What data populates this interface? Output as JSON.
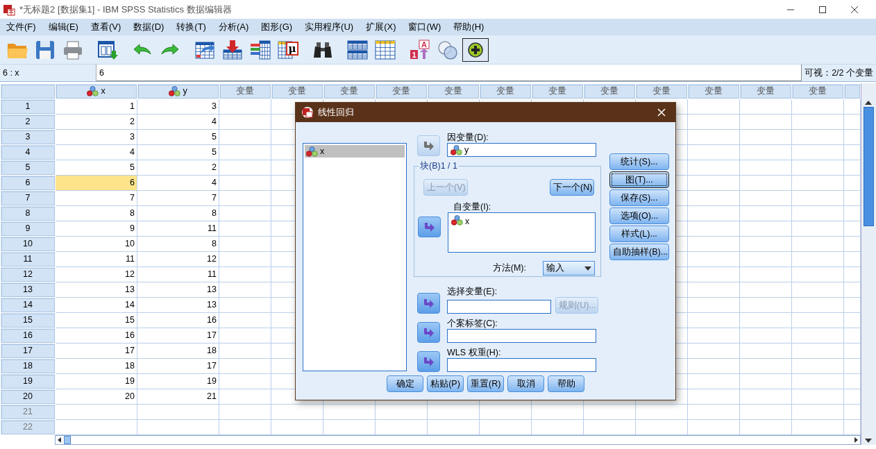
{
  "window": {
    "title": "*无标题2 [数据集1] - IBM SPSS Statistics 数据编辑器"
  },
  "menu": [
    "文件(F)",
    "编辑(E)",
    "查看(V)",
    "数据(D)",
    "转换(T)",
    "分析(A)",
    "图形(G)",
    "实用程序(U)",
    "扩展(X)",
    "窗口(W)",
    "帮助(H)"
  ],
  "toolbar": [
    [
      {
        "kind": "folder",
        "selected": false
      },
      {
        "kind": "floppy",
        "selected": false
      },
      {
        "kind": "printer",
        "selected": false
      }
    ],
    [
      {
        "kind": "window-arrow",
        "selected": false
      }
    ],
    [
      {
        "kind": "undo",
        "selected": false
      },
      {
        "kind": "redo",
        "selected": false
      }
    ],
    [
      {
        "kind": "grid-arrow",
        "selected": false
      },
      {
        "kind": "grid-down",
        "selected": false
      },
      {
        "kind": "grid-bars",
        "selected": false
      },
      {
        "kind": "grid-mu",
        "selected": false,
        "text": [
          "μ"
        ]
      }
    ],
    [
      {
        "kind": "binoculars",
        "selected": false
      }
    ],
    [
      {
        "kind": "two-grids",
        "selected": false
      },
      {
        "kind": "grid-plain",
        "selected": false
      }
    ],
    [
      {
        "kind": "labels",
        "selected": false,
        "text": [
          "A",
          "1"
        ]
      },
      {
        "kind": "circles",
        "selected": false
      },
      {
        "kind": "plus-circle",
        "selected": true
      }
    ]
  ],
  "cell_bar": {
    "reference": "6 : x",
    "value": "6",
    "visible": "可视：2/2 个变量"
  },
  "grid": {
    "columns": [
      {
        "label": "x",
        "kind": "variable"
      },
      {
        "label": "y",
        "kind": "variable"
      },
      {
        "label": "变量",
        "kind": "empty"
      },
      {
        "label": "变量",
        "kind": "empty"
      },
      {
        "label": "变量",
        "kind": "empty"
      },
      {
        "label": "变量",
        "kind": "empty"
      },
      {
        "label": "变量",
        "kind": "empty"
      },
      {
        "label": "变量",
        "kind": "empty"
      },
      {
        "label": "变量",
        "kind": "empty"
      },
      {
        "label": "变量",
        "kind": "empty"
      },
      {
        "label": "变量",
        "kind": "empty"
      },
      {
        "label": "变量",
        "kind": "empty"
      },
      {
        "label": "变量",
        "kind": "empty"
      },
      {
        "label": "变量",
        "kind": "empty"
      }
    ],
    "rows": [
      {
        "label": "1",
        "kind": "data",
        "cells": [
          {
            "value": "1",
            "selected": false
          },
          {
            "value": "3",
            "selected": false
          }
        ]
      },
      {
        "label": "2",
        "kind": "data",
        "cells": [
          {
            "value": "2",
            "selected": false
          },
          {
            "value": "4",
            "selected": false
          }
        ]
      },
      {
        "label": "3",
        "kind": "data",
        "cells": [
          {
            "value": "3",
            "selected": false
          },
          {
            "value": "5",
            "selected": false
          }
        ]
      },
      {
        "label": "4",
        "kind": "data",
        "cells": [
          {
            "value": "4",
            "selected": false
          },
          {
            "value": "5",
            "selected": false
          }
        ]
      },
      {
        "label": "5",
        "kind": "data",
        "cells": [
          {
            "value": "5",
            "selected": false
          },
          {
            "value": "2",
            "selected": false
          }
        ]
      },
      {
        "label": "6",
        "kind": "data",
        "cells": [
          {
            "value": "6",
            "selected": true
          },
          {
            "value": "4",
            "selected": false
          }
        ]
      },
      {
        "label": "7",
        "kind": "data",
        "cells": [
          {
            "value": "7",
            "selected": false
          },
          {
            "value": "7",
            "selected": false
          }
        ]
      },
      {
        "label": "8",
        "kind": "data",
        "cells": [
          {
            "value": "8",
            "selected": false
          },
          {
            "value": "8",
            "selected": false
          }
        ]
      },
      {
        "label": "9",
        "kind": "data",
        "cells": [
          {
            "value": "9",
            "selected": false
          },
          {
            "value": "11",
            "selected": false
          }
        ]
      },
      {
        "label": "10",
        "kind": "data",
        "cells": [
          {
            "value": "10",
            "selected": false
          },
          {
            "value": "8",
            "selected": false
          }
        ]
      },
      {
        "label": "11",
        "kind": "data",
        "cells": [
          {
            "value": "11",
            "selected": false
          },
          {
            "value": "12",
            "selected": false
          }
        ]
      },
      {
        "label": "12",
        "kind": "data",
        "cells": [
          {
            "value": "12",
            "selected": false
          },
          {
            "value": "11",
            "selected": false
          }
        ]
      },
      {
        "label": "13",
        "kind": "data",
        "cells": [
          {
            "value": "13",
            "selected": false
          },
          {
            "value": "13",
            "selected": false
          }
        ]
      },
      {
        "label": "14",
        "kind": "data",
        "cells": [
          {
            "value": "14",
            "selected": false
          },
          {
            "value": "13",
            "selected": false
          }
        ]
      },
      {
        "label": "15",
        "kind": "data",
        "cells": [
          {
            "value": "15",
            "selected": false
          },
          {
            "value": "16",
            "selected": false
          }
        ]
      },
      {
        "label": "16",
        "kind": "data",
        "cells": [
          {
            "value": "16",
            "selected": false
          },
          {
            "value": "17",
            "selected": false
          }
        ]
      },
      {
        "label": "17",
        "kind": "data",
        "cells": [
          {
            "value": "17",
            "selected": false
          },
          {
            "value": "18",
            "selected": false
          }
        ]
      },
      {
        "label": "18",
        "kind": "data",
        "cells": [
          {
            "value": "18",
            "selected": false
          },
          {
            "value": "17",
            "selected": false
          }
        ]
      },
      {
        "label": "19",
        "kind": "data",
        "cells": [
          {
            "value": "19",
            "selected": false
          },
          {
            "value": "19",
            "selected": false
          }
        ]
      },
      {
        "label": "20",
        "kind": "data",
        "cells": [
          {
            "value": "20",
            "selected": false
          },
          {
            "value": "21",
            "selected": false
          }
        ]
      },
      {
        "label": "21",
        "kind": "empty"
      },
      {
        "label": "22",
        "kind": "empty"
      }
    ]
  },
  "dialog": {
    "title": "线性回归",
    "source_list": [
      {
        "label": "x",
        "selected": true
      }
    ],
    "dependent": {
      "label": "因变量(D):",
      "arrow_disabled": true,
      "items": [
        "y"
      ]
    },
    "block": {
      "legend": "块(B)1 / 1",
      "previous": {
        "label": "上一个(V)",
        "disabled": true
      },
      "next": {
        "label": "下一个(N)",
        "disabled": false
      },
      "independent": {
        "label": "自变量(I):",
        "arrow_disabled": false,
        "items": [
          "x"
        ]
      },
      "method": {
        "label": "方法(M):",
        "value": "输入"
      }
    },
    "selection": {
      "label": "选择变量(E):",
      "arrow_disabled": false,
      "rule": {
        "label": "规则(U)...",
        "disabled": true
      }
    },
    "case_labels": {
      "label": "个案标签(C):",
      "arrow_disabled": false
    },
    "wls": {
      "label": "WLS 权重(H):",
      "arrow_disabled": false
    },
    "side_buttons": [
      {
        "label": "统计(S)...",
        "focused": false
      },
      {
        "label": "图(T)...",
        "focused": true
      },
      {
        "label": "保存(S)...",
        "focused": false
      },
      {
        "label": "选项(O)...",
        "focused": false
      },
      {
        "label": "样式(L)...",
        "focused": false
      },
      {
        "label": "自助抽样(B)...",
        "focused": false
      }
    ],
    "buttons": [
      "确定",
      "粘贴(P)",
      "重置(R)",
      "取消",
      "帮助"
    ]
  }
}
